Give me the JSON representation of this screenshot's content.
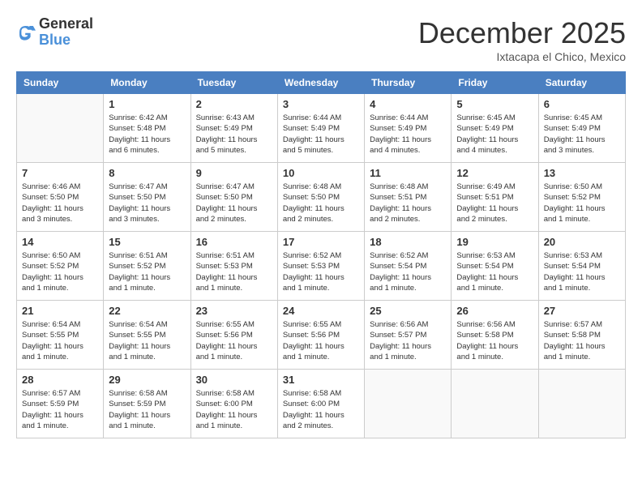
{
  "header": {
    "logo": {
      "general": "General",
      "blue": "Blue"
    },
    "month": "December 2025",
    "location": "Ixtacapa el Chico, Mexico"
  },
  "weekdays": [
    "Sunday",
    "Monday",
    "Tuesday",
    "Wednesday",
    "Thursday",
    "Friday",
    "Saturday"
  ],
  "weeks": [
    [
      {
        "day": null
      },
      {
        "day": 1,
        "sunrise": "6:42 AM",
        "sunset": "5:48 PM",
        "daylight": "11 hours and 6 minutes."
      },
      {
        "day": 2,
        "sunrise": "6:43 AM",
        "sunset": "5:49 PM",
        "daylight": "11 hours and 5 minutes."
      },
      {
        "day": 3,
        "sunrise": "6:44 AM",
        "sunset": "5:49 PM",
        "daylight": "11 hours and 5 minutes."
      },
      {
        "day": 4,
        "sunrise": "6:44 AM",
        "sunset": "5:49 PM",
        "daylight": "11 hours and 4 minutes."
      },
      {
        "day": 5,
        "sunrise": "6:45 AM",
        "sunset": "5:49 PM",
        "daylight": "11 hours and 4 minutes."
      },
      {
        "day": 6,
        "sunrise": "6:45 AM",
        "sunset": "5:49 PM",
        "daylight": "11 hours and 3 minutes."
      }
    ],
    [
      {
        "day": 7,
        "sunrise": "6:46 AM",
        "sunset": "5:50 PM",
        "daylight": "11 hours and 3 minutes."
      },
      {
        "day": 8,
        "sunrise": "6:47 AM",
        "sunset": "5:50 PM",
        "daylight": "11 hours and 3 minutes."
      },
      {
        "day": 9,
        "sunrise": "6:47 AM",
        "sunset": "5:50 PM",
        "daylight": "11 hours and 2 minutes."
      },
      {
        "day": 10,
        "sunrise": "6:48 AM",
        "sunset": "5:50 PM",
        "daylight": "11 hours and 2 minutes."
      },
      {
        "day": 11,
        "sunrise": "6:48 AM",
        "sunset": "5:51 PM",
        "daylight": "11 hours and 2 minutes."
      },
      {
        "day": 12,
        "sunrise": "6:49 AM",
        "sunset": "5:51 PM",
        "daylight": "11 hours and 2 minutes."
      },
      {
        "day": 13,
        "sunrise": "6:50 AM",
        "sunset": "5:52 PM",
        "daylight": "11 hours and 1 minute."
      }
    ],
    [
      {
        "day": 14,
        "sunrise": "6:50 AM",
        "sunset": "5:52 PM",
        "daylight": "11 hours and 1 minute."
      },
      {
        "day": 15,
        "sunrise": "6:51 AM",
        "sunset": "5:52 PM",
        "daylight": "11 hours and 1 minute."
      },
      {
        "day": 16,
        "sunrise": "6:51 AM",
        "sunset": "5:53 PM",
        "daylight": "11 hours and 1 minute."
      },
      {
        "day": 17,
        "sunrise": "6:52 AM",
        "sunset": "5:53 PM",
        "daylight": "11 hours and 1 minute."
      },
      {
        "day": 18,
        "sunrise": "6:52 AM",
        "sunset": "5:54 PM",
        "daylight": "11 hours and 1 minute."
      },
      {
        "day": 19,
        "sunrise": "6:53 AM",
        "sunset": "5:54 PM",
        "daylight": "11 hours and 1 minute."
      },
      {
        "day": 20,
        "sunrise": "6:53 AM",
        "sunset": "5:54 PM",
        "daylight": "11 hours and 1 minute."
      }
    ],
    [
      {
        "day": 21,
        "sunrise": "6:54 AM",
        "sunset": "5:55 PM",
        "daylight": "11 hours and 1 minute."
      },
      {
        "day": 22,
        "sunrise": "6:54 AM",
        "sunset": "5:55 PM",
        "daylight": "11 hours and 1 minute."
      },
      {
        "day": 23,
        "sunrise": "6:55 AM",
        "sunset": "5:56 PM",
        "daylight": "11 hours and 1 minute."
      },
      {
        "day": 24,
        "sunrise": "6:55 AM",
        "sunset": "5:56 PM",
        "daylight": "11 hours and 1 minute."
      },
      {
        "day": 25,
        "sunrise": "6:56 AM",
        "sunset": "5:57 PM",
        "daylight": "11 hours and 1 minute."
      },
      {
        "day": 26,
        "sunrise": "6:56 AM",
        "sunset": "5:58 PM",
        "daylight": "11 hours and 1 minute."
      },
      {
        "day": 27,
        "sunrise": "6:57 AM",
        "sunset": "5:58 PM",
        "daylight": "11 hours and 1 minute."
      }
    ],
    [
      {
        "day": 28,
        "sunrise": "6:57 AM",
        "sunset": "5:59 PM",
        "daylight": "11 hours and 1 minute."
      },
      {
        "day": 29,
        "sunrise": "6:58 AM",
        "sunset": "5:59 PM",
        "daylight": "11 hours and 1 minute."
      },
      {
        "day": 30,
        "sunrise": "6:58 AM",
        "sunset": "6:00 PM",
        "daylight": "11 hours and 1 minute."
      },
      {
        "day": 31,
        "sunrise": "6:58 AM",
        "sunset": "6:00 PM",
        "daylight": "11 hours and 2 minutes."
      },
      {
        "day": null
      },
      {
        "day": null
      },
      {
        "day": null
      }
    ]
  ]
}
